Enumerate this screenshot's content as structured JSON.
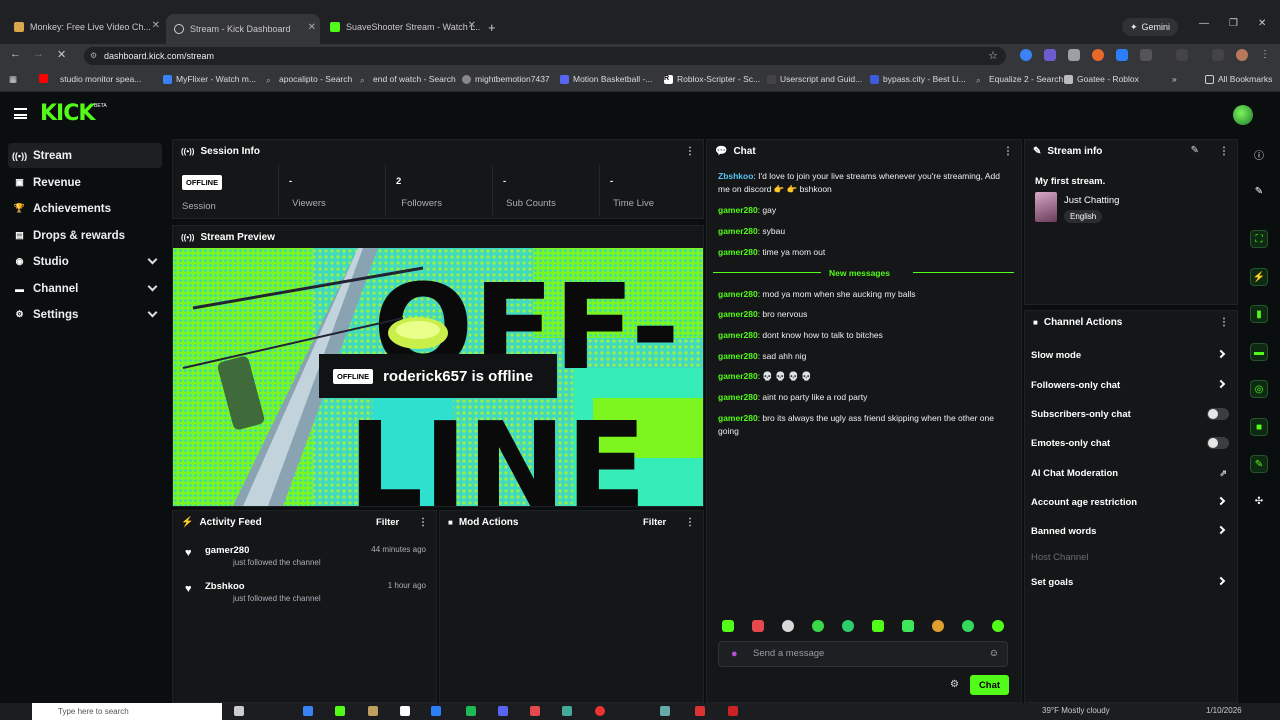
{
  "browser": {
    "tabs": [
      {
        "label": "Monkey: Free Live Video Ch...",
        "active": false
      },
      {
        "label": "Stream - Kick Dashboard",
        "active": true
      },
      {
        "label": "SuaveShooter Stream - Watch L...",
        "active": false
      }
    ],
    "gemini_label": "Gemini",
    "url": "dashboard.kick.com/stream",
    "bookmarks": [
      "studio monitor spea...",
      "MyFlixer - Watch m...",
      "apocalipto - Search",
      "end of watch - Search",
      "mightbemotion7437",
      "Motion Basketball -...",
      "Roblox-Scripter - Sc...",
      "Userscript and Guid...",
      "bypass.city - Best Li...",
      "Equalize 2 - Search",
      "Goatee - Roblox",
      "All Bookmarks"
    ]
  },
  "header": {
    "logo": "KICK",
    "beta": "BETA"
  },
  "sidebar": {
    "items": [
      {
        "label": "Stream",
        "icon": "broadcast-icon"
      },
      {
        "label": "Revenue",
        "icon": "revenue-icon"
      },
      {
        "label": "Achievements",
        "icon": "trophy-icon"
      },
      {
        "label": "Drops & rewards",
        "icon": "gift-icon"
      },
      {
        "label": "Studio",
        "icon": "studio-icon"
      },
      {
        "label": "Channel",
        "icon": "channel-icon"
      },
      {
        "label": "Settings",
        "icon": "gear-icon"
      }
    ]
  },
  "session": {
    "title": "Session Info",
    "status": "OFFLINE",
    "status_label": "Session",
    "stats": [
      {
        "value": "-",
        "label": "Viewers"
      },
      {
        "value": "2",
        "label": "Followers"
      },
      {
        "value": "-",
        "label": "Sub Counts"
      },
      {
        "value": "-",
        "label": "Time Live"
      }
    ]
  },
  "preview": {
    "title": "Stream Preview",
    "pill": "OFFLINE",
    "message": "roderick657 is offline",
    "art_text_top": "OFF-",
    "art_text_bottom": "LINE"
  },
  "activity": {
    "title": "Activity Feed",
    "filter": "Filter",
    "items": [
      {
        "name": "gamer280",
        "text": "just followed the channel",
        "time": "44 minutes ago"
      },
      {
        "name": "Zbshkoo",
        "text": "just followed the channel",
        "time": "1 hour ago"
      }
    ]
  },
  "mod_actions": {
    "title": "Mod Actions",
    "filter": "Filter"
  },
  "chat": {
    "title": "Chat",
    "messages_before": [
      {
        "user": "Zbshkoo",
        "text": ": I'd love to join your live streams whenever you're streaming, Add me on discord 👉 👉 bshkoon"
      },
      {
        "user": "gamer280",
        "text": ": gay"
      },
      {
        "user": "gamer280",
        "text": ": sybau"
      },
      {
        "user": "gamer280",
        "text": ": time ya mom out"
      }
    ],
    "new_messages_label": "New messages",
    "messages_after": [
      {
        "user": "gamer280",
        "text": ": mod ya mom when she aucking my balls"
      },
      {
        "user": "gamer280",
        "text": ": bro nervous"
      },
      {
        "user": "gamer280",
        "text": ": dont know how to talk to bitches"
      },
      {
        "user": "gamer280",
        "text": ": sad ahh nig"
      },
      {
        "user": "gamer280",
        "text": ": 💀 💀 💀 💀"
      },
      {
        "user": "gamer280",
        "text": ": aint no party like a rod party"
      },
      {
        "user": "gamer280",
        "text": ": bro its always the ugly ass friend skipping when the other one going"
      }
    ],
    "placeholder": "Send a message",
    "send_label": "Chat"
  },
  "stream_info": {
    "title": "Stream info",
    "stream_title": "My first stream.",
    "category": "Just Chatting",
    "language": "English"
  },
  "channel_actions": {
    "title": "Channel Actions",
    "items": [
      {
        "label": "Slow mode",
        "control": "arrow"
      },
      {
        "label": "Followers-only chat",
        "control": "arrow"
      },
      {
        "label": "Subscribers-only chat",
        "control": "toggle"
      },
      {
        "label": "Emotes-only chat",
        "control": "toggle"
      },
      {
        "label": "AI Chat Moderation",
        "control": "external"
      },
      {
        "label": "Account age restriction",
        "control": "arrow"
      },
      {
        "label": "Banned words",
        "control": "arrow"
      },
      {
        "label": "Host Channel",
        "control": "none"
      },
      {
        "label": "Set goals",
        "control": "arrow"
      }
    ]
  },
  "taskbar": {
    "search_placeholder": "Type here to search",
    "weather": "39°F Mostly cloudy",
    "date": "1/10/2026"
  },
  "colors": {
    "accent": "#53fc18",
    "bg": "#0b0e0f",
    "panel": "#141618"
  }
}
